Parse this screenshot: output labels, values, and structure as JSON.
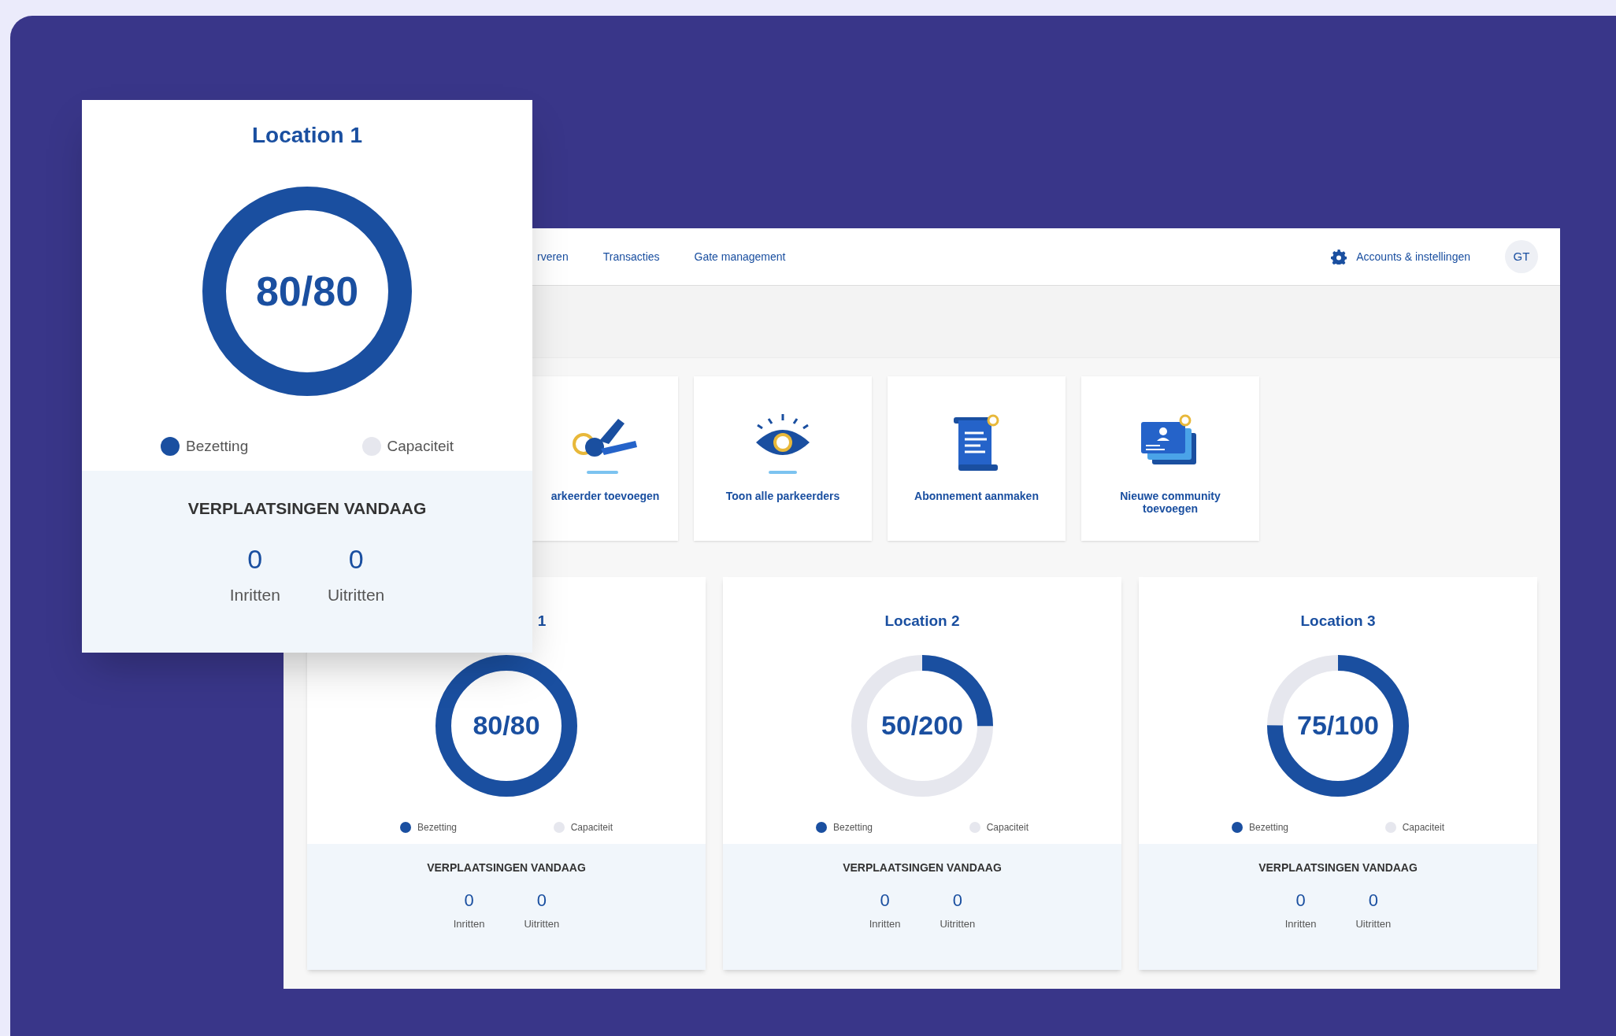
{
  "overlay_card": {
    "title": "Location 1",
    "reading": "80/80",
    "level": 1,
    "legend": [
      {
        "label": "Bezetting",
        "color": "#1a4fa0"
      },
      {
        "label": "Capaciteit",
        "color": "#e6e7ee"
      }
    ],
    "section_title": "VERPLAATSINGEN VANDAAG",
    "stats": [
      {
        "value": "0",
        "label": "Inritten"
      },
      {
        "value": "0",
        "label": "Uitritten"
      }
    ]
  },
  "app": {
    "nav": {
      "items": [
        "rveren",
        "Transacties",
        "Gate management"
      ],
      "settings_label": "Accounts & instellingen",
      "avatar": "GT"
    },
    "tiles": [
      {
        "kind": "keys",
        "label": "arkeerder toevoegen"
      },
      {
        "kind": "eye",
        "label": "Toon alle parkeerders"
      },
      {
        "kind": "scroll",
        "label": "Abonnement aanmaken"
      },
      {
        "kind": "cards",
        "label": "Nieuwe community toevoegen"
      }
    ],
    "locations": [
      {
        "title": "1",
        "reading": "80/80",
        "level": 1,
        "legend": [
          {
            "label": "Bezetting",
            "color": "#1a4fa0"
          },
          {
            "label": "Capaciteit",
            "color": "#e6e7ee"
          }
        ],
        "section_title": "VERPLAATSINGEN VANDAAG",
        "stats": [
          {
            "value": "0",
            "label": "Inritten"
          },
          {
            "value": "0",
            "label": "Uitritten"
          }
        ]
      },
      {
        "title": "Location 2",
        "reading": "50/200",
        "level": 0.25,
        "legend": [
          {
            "label": "Bezetting",
            "color": "#1a4fa0"
          },
          {
            "label": "Capaciteit",
            "color": "#e6e7ee"
          }
        ],
        "section_title": "VERPLAATSINGEN VANDAAG",
        "stats": [
          {
            "value": "0",
            "label": "Inritten"
          },
          {
            "value": "0",
            "label": "Uitritten"
          }
        ]
      },
      {
        "title": "Location 3",
        "reading": "75/100",
        "level": 0.75,
        "legend": [
          {
            "label": "Bezetting",
            "color": "#1a4fa0"
          },
          {
            "label": "Capaciteit",
            "color": "#e6e7ee"
          }
        ],
        "section_title": "VERPLAATSINGEN VANDAAG",
        "stats": [
          {
            "value": "0",
            "label": "Inritten"
          },
          {
            "value": "0",
            "label": "Uitritten"
          }
        ]
      }
    ]
  }
}
